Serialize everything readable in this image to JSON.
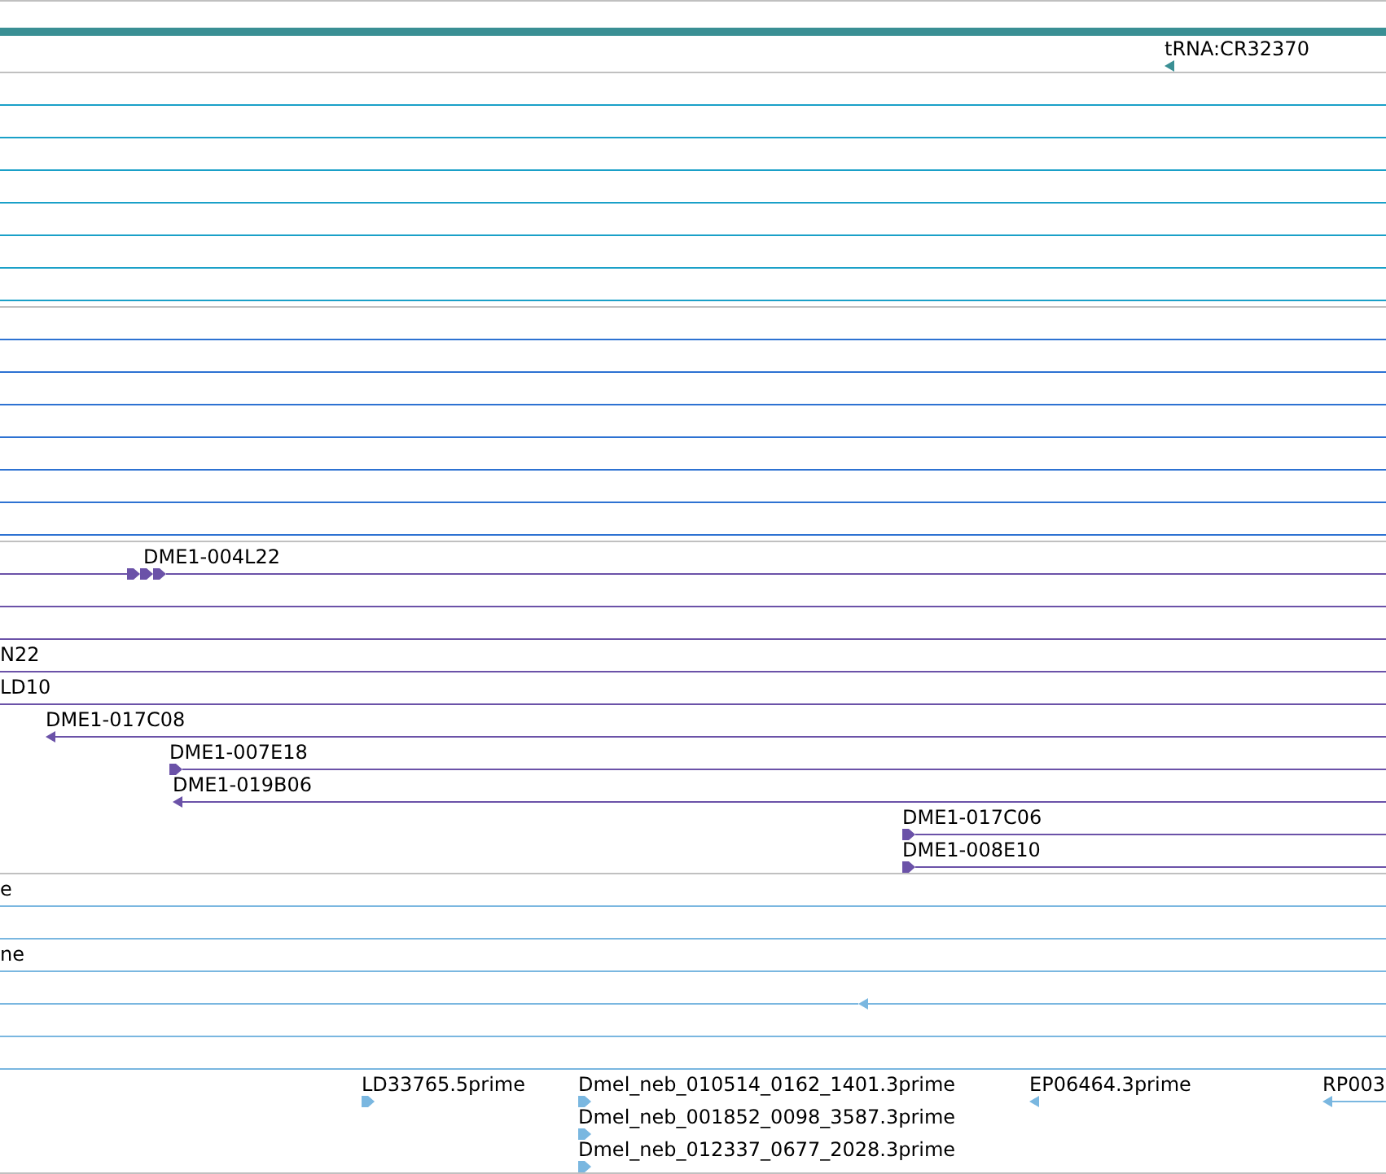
{
  "tracks": [
    {
      "color": "#3a8f94",
      "rows": [
        {
          "kind": "bar"
        },
        {
          "kind": "plain",
          "features": [
            {
              "label": "tRNA:CR32370",
              "reverse": true
            }
          ]
        }
      ]
    },
    {
      "color": "#1aa0c8",
      "rows": [
        {
          "kind": "line"
        },
        {
          "kind": "line"
        },
        {
          "kind": "line"
        },
        {
          "kind": "line"
        },
        {
          "kind": "line"
        },
        {
          "kind": "line"
        },
        {
          "kind": "line"
        }
      ]
    },
    {
      "color": "#2d72d2",
      "rows": [
        {
          "kind": "line"
        },
        {
          "kind": "line"
        },
        {
          "kind": "line"
        },
        {
          "kind": "line"
        },
        {
          "kind": "line"
        },
        {
          "kind": "line"
        },
        {
          "kind": "line"
        }
      ]
    },
    {
      "color": "#6b52a8",
      "rows": [
        {
          "kind": "line",
          "features": [
            {
              "label": "DME1-004L22",
              "reverse": false
            }
          ]
        },
        {
          "kind": "line"
        },
        {
          "kind": "line"
        },
        {
          "kind": "line",
          "features": [
            {
              "label": "N22"
            }
          ]
        },
        {
          "kind": "line",
          "features": [
            {
              "label": "LD10"
            }
          ]
        },
        {
          "kind": "line",
          "features": [
            {
              "label": "DME1-017C08",
              "reverse": true
            }
          ]
        },
        {
          "kind": "line",
          "features": [
            {
              "label": "DME1-007E18",
              "reverse": false
            }
          ]
        },
        {
          "kind": "line",
          "features": [
            {
              "label": "DME1-019B06",
              "reverse": true
            }
          ]
        },
        {
          "kind": "line",
          "features": [
            {
              "label": "DME1-017C06",
              "reverse": false
            }
          ]
        },
        {
          "kind": "line",
          "features": [
            {
              "label": "DME1-008E10",
              "reverse": false
            }
          ]
        }
      ]
    },
    {
      "color": "#7ab7e0",
      "rows": [
        {
          "kind": "line",
          "features": [
            {
              "label": "e"
            }
          ]
        },
        {
          "kind": "line"
        },
        {
          "kind": "line",
          "features": [
            {
              "label": "ne"
            }
          ]
        },
        {
          "kind": "line",
          "features": [
            {
              "reverse": true
            }
          ]
        },
        {
          "kind": "line"
        },
        {
          "kind": "line"
        },
        {
          "kind": "line",
          "features": [
            {
              "label": "LD33765.5prime",
              "reverse": false
            },
            {
              "label": "Dmel_neb_010514_0162_1401.3prime",
              "reverse": false
            },
            {
              "label": "EP06464.3prime",
              "reverse": true
            },
            {
              "label": "RP003",
              "reverse": true
            }
          ]
        },
        {
          "kind": "plain",
          "features": [
            {
              "label": "Dmel_neb_001852_0098_3587.3prime",
              "reverse": false
            }
          ]
        },
        {
          "kind": "plain",
          "features": [
            {
              "label": "Dmel_neb_012337_0677_2028.3prime",
              "reverse": false
            }
          ]
        }
      ]
    }
  ]
}
